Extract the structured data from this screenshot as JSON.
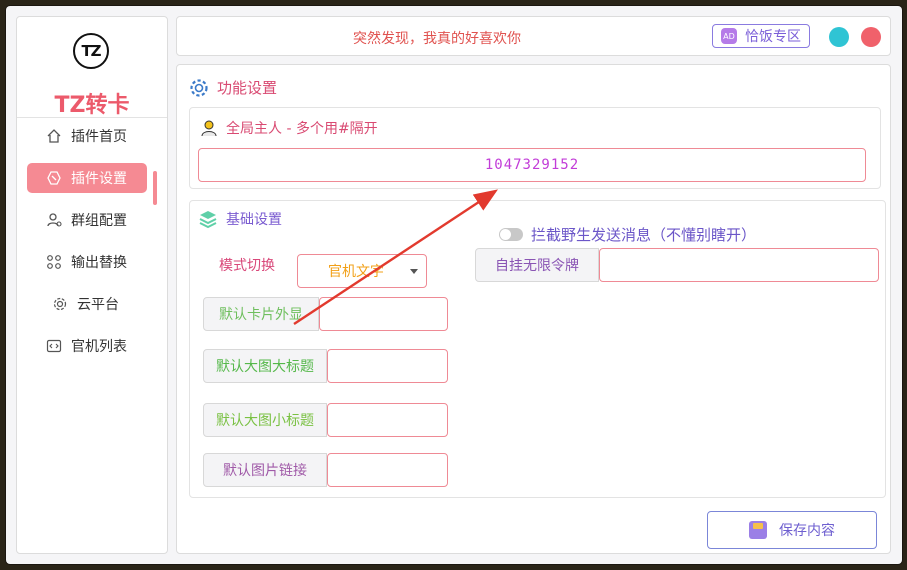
{
  "brand": {
    "logo_text": "TZ",
    "name": "TZ转卡"
  },
  "sidebar": {
    "items": [
      {
        "label": "插件首页",
        "icon": "home-icon"
      },
      {
        "label": "插件设置",
        "icon": "plugin-settings-icon",
        "active": true
      },
      {
        "label": "群组配置",
        "icon": "group-user-icon"
      },
      {
        "label": "输出替换",
        "icon": "grid-icon"
      },
      {
        "label": "云平台",
        "icon": "gear-icon"
      },
      {
        "label": "官机列表",
        "icon": "code-icon"
      }
    ]
  },
  "header": {
    "marquee": "突然发现，我真的好喜欢你",
    "zone_button": "恰饭专区",
    "colors": {
      "minimize": "#2fc4d4",
      "close": "#f0616b"
    }
  },
  "main": {
    "section_title": "功能设置",
    "owner": {
      "title": "全局主人 - 多个用#隔开",
      "value": "1047329152"
    },
    "basic": {
      "title": "基础设置",
      "mode_label": "模式切换",
      "mode_value": "官机文字",
      "toggle_label": "拦截野生发送消息（不懂别瞎开）",
      "fields": [
        {
          "label": "默认卡片外显",
          "value": "",
          "color": "#6fbf5e"
        },
        {
          "label": "默认大图大标题",
          "value": "",
          "color": "#55b84a"
        },
        {
          "label": "默认大图小标题",
          "value": "",
          "color": "#7ac143"
        },
        {
          "label": "默认图片链接",
          "value": "",
          "color": "#a05aa8"
        }
      ],
      "token": {
        "label": "自挂无限令牌",
        "value": "",
        "color": "#8a55b4"
      }
    },
    "save_button": "保存内容"
  }
}
